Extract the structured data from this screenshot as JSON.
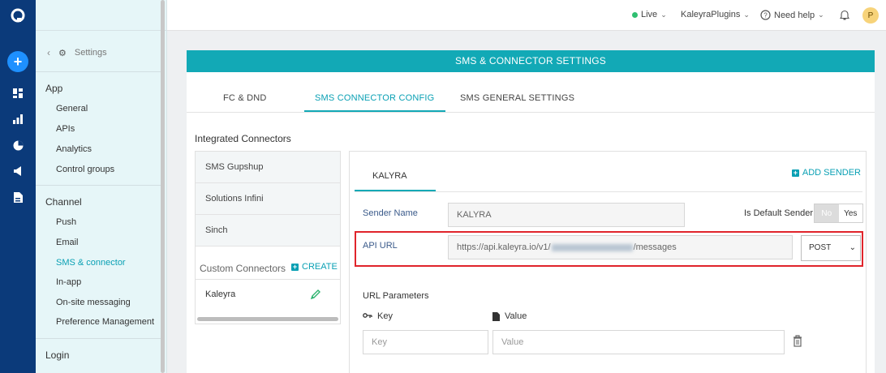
{
  "topbar": {
    "env": "Live",
    "account": "KaleyraPlugins",
    "help": "Need help",
    "avatar_initial": "P"
  },
  "sidebar": {
    "back_label": "Settings",
    "sections": [
      {
        "title": "App",
        "items": [
          "General",
          "APIs",
          "Analytics",
          "Control groups"
        ]
      },
      {
        "title": "Channel",
        "items": [
          "Push",
          "Email",
          "SMS & connector",
          "In-app",
          "On-site messaging",
          "Preference Management"
        ]
      },
      {
        "title": "Login"
      }
    ],
    "active_item": "SMS & connector"
  },
  "page": {
    "header": "SMS & CONNECTOR SETTINGS",
    "tabs": [
      "FC & DND",
      "SMS CONNECTOR CONFIG",
      "SMS GENERAL SETTINGS"
    ],
    "active_tab": "SMS CONNECTOR CONFIG"
  },
  "connectors": {
    "integrated_label": "Integrated Connectors",
    "integrated": [
      "SMS Gupshup",
      "Solutions Infini",
      "Sinch"
    ],
    "custom_label": "Custom Connectors",
    "create_label": "CREATE",
    "custom": [
      "Kaleyra"
    ]
  },
  "detail": {
    "tab": "KALYRA",
    "add_sender_label": "ADD SENDER",
    "sender_name_label": "Sender Name",
    "sender_name_value": "KALYRA",
    "is_default_label": "Is Default Sender",
    "toggle_no": "No",
    "toggle_yes": "Yes",
    "api_url_label": "API URL",
    "api_url_prefix": "https://api.kaleyra.io/v1/",
    "api_url_suffix": "/messages",
    "method": "POST",
    "url_params_label": "URL Parameters",
    "key_header": "Key",
    "value_header": "Value",
    "key_placeholder": "Key",
    "value_placeholder": "Value"
  }
}
